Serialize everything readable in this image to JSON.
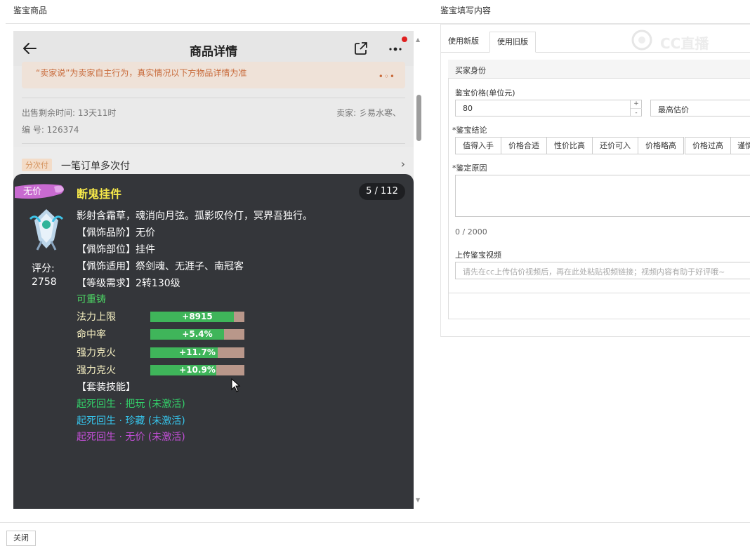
{
  "sections": {
    "left": "鉴宝商品",
    "right": "鉴宝填写内容"
  },
  "phone": {
    "title": "商品详情",
    "notice": "“卖家说”为卖家自主行为，真实情况以下方物品详情为准",
    "notice_dots": "•◦•",
    "remaining": "出售剩余时间: 13天11时",
    "seller": "卖家: 彡易水寒、",
    "serial": "编 号: 126374",
    "pay_badge": "分次付",
    "pay_text": "一笔订单多次付",
    "pay_chevron": "›"
  },
  "card": {
    "ribbon": "无价",
    "name": "断鬼挂件",
    "page": "5 / 112",
    "score_label": "评分:",
    "score": "2758",
    "desc": [
      "影射含霜草，魂消向月弦。孤影叹伶仃，冥界吾独行。",
      "【佩饰品阶】无价",
      "【佩饰部位】挂件",
      "【佩饰适用】祭剑魂、无涯子、南冠客",
      "【等级需求】2转130级"
    ],
    "recast": "可重铸",
    "stats": [
      {
        "label": "法力上限",
        "value": "+8915",
        "fill": 0.89
      },
      {
        "label": "命中率",
        "value": "+5.4%",
        "fill": 0.78
      },
      {
        "label": "强力克火",
        "value": "+11.7%",
        "fill": 0.72
      },
      {
        "label": "强力克火",
        "value": "+10.9%",
        "fill": 0.7
      }
    ],
    "set_title": "【套装技能】",
    "skills": [
      {
        "text": "起死回生 · 把玩 (未激活)",
        "color": "#33d16a"
      },
      {
        "text": "起死回生 · 珍藏 (未激活)",
        "color": "#36c3ea"
      },
      {
        "text": "起死回生 · 无价 (未激活)",
        "color": "#c24fd6"
      }
    ]
  },
  "form": {
    "tabs": [
      "使用新版",
      "使用旧版"
    ],
    "panel_title": "买家身份",
    "price_label": "鉴宝价格(单位元)",
    "price_value": "80",
    "spin_up": "+",
    "spin_down": "-",
    "estimate": "最高估价",
    "conclusion_label": "*鉴宝结论",
    "conclusions": [
      "值得入手",
      "价格合适",
      "性价比高",
      "还价可入",
      "价格略高",
      "价格过高",
      "谨慎"
    ],
    "reason_label": "*鉴定原因",
    "count": "0 / 2000",
    "video_label": "上传鉴宝视频",
    "video_placeholder": "请先在cc上传估价视频后，再在此处粘贴视频链接；视频内容有助于好评哦~",
    "logo_text": "CC直播"
  },
  "footer": {
    "close": "关闭"
  }
}
